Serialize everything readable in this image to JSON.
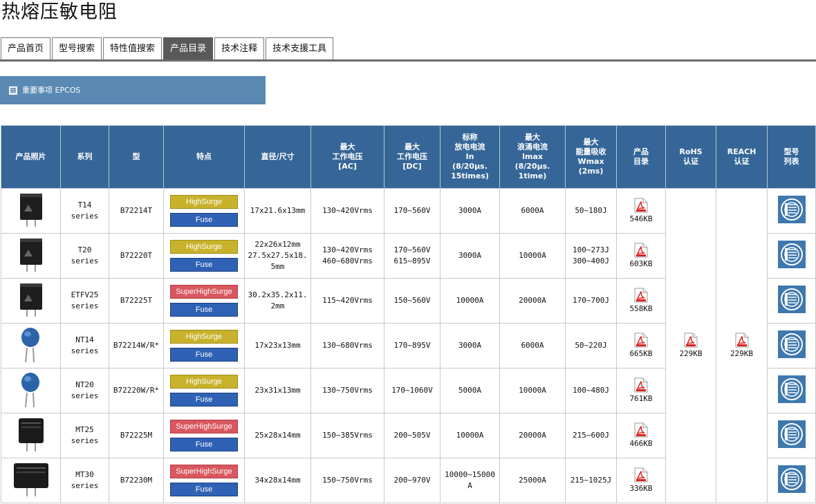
{
  "page": {
    "title": "热熔压敏电阻"
  },
  "tabs": [
    "产品首页",
    "型号搜索",
    "特性值搜索",
    "产品目录",
    "技术注释",
    "技术支援工具"
  ],
  "notice": {
    "label": "重要事项 EPCOS"
  },
  "table": {
    "headers": [
      [
        "产品照片"
      ],
      [
        "系列"
      ],
      [
        "型"
      ],
      [
        "特点"
      ],
      [
        "直径/尺寸"
      ],
      [
        "最大",
        "工作电压",
        "[AC]"
      ],
      [
        "最大",
        "工作电压",
        "[DC]"
      ],
      [
        "标称",
        "放电电流",
        "In",
        "(8/20µs.",
        "15times)"
      ],
      [
        "最大",
        "浪涌电流",
        "Imax",
        "(8/20µs.",
        "1time)"
      ],
      [
        "最大",
        "能量吸收",
        "Wmax",
        "(2ms)"
      ],
      [
        "产品",
        "目录"
      ],
      [
        "RoHS",
        "认证"
      ],
      [
        "REACH",
        "认证"
      ],
      [
        "型号",
        "列表"
      ]
    ],
    "rows": [
      {
        "series": [
          "T14",
          "series"
        ],
        "type": "B72214T",
        "feature": "HighSurge",
        "fuse": "Fuse",
        "dimension": [
          "17x21.6x13mm"
        ],
        "vac": [
          "130~420Vrms"
        ],
        "vdc": [
          "170~560V"
        ],
        "in": [
          "3000A"
        ],
        "imax": "6000A",
        "wmax": [
          "50~180J"
        ],
        "catalog": "546KB",
        "image": "black-box"
      },
      {
        "series": [
          "T20",
          "series"
        ],
        "type": "B72220T",
        "feature": "HighSurge",
        "fuse": "Fuse",
        "dimension": [
          "22x26x12mm",
          "27.5x27.5x18.",
          "5mm"
        ],
        "vac": [
          "130~420Vrms",
          "460~680Vrms"
        ],
        "vdc": [
          "170~560V",
          "615~895V"
        ],
        "in": [
          "3000A"
        ],
        "imax": "10000A",
        "wmax": [
          "100~273J",
          "300~400J"
        ],
        "catalog": "603KB",
        "image": "black-box"
      },
      {
        "series": [
          "ETFV25",
          "series"
        ],
        "type": "B72225T",
        "feature": "SuperHighSurge",
        "fuse": "Fuse",
        "dimension": [
          "30.2x35.2x11.",
          "2mm"
        ],
        "vac": [
          "115~420Vrms"
        ],
        "vdc": [
          "150~560V"
        ],
        "in": [
          "10000A"
        ],
        "imax": "20000A",
        "wmax": [
          "170~700J"
        ],
        "catalog": "558KB",
        "image": "black-box"
      },
      {
        "series": [
          "NT14",
          "series"
        ],
        "type": "B72214W/R*",
        "feature": "HighSurge",
        "fuse": "Fuse",
        "dimension": [
          "17x23x13mm"
        ],
        "vac": [
          "130~680Vrms"
        ],
        "vdc": [
          "170~895V"
        ],
        "in": [
          "3000A"
        ],
        "imax": "6000A",
        "wmax": [
          "50~220J"
        ],
        "catalog": "665KB",
        "image": "blue-disc"
      },
      {
        "series": [
          "NT20",
          "series"
        ],
        "type": "B72220W/R*",
        "feature": "HighSurge",
        "fuse": "Fuse",
        "dimension": [
          "23x31x13mm"
        ],
        "vac": [
          "130~750Vrms"
        ],
        "vdc": [
          "170~1060V"
        ],
        "in": [
          "5000A"
        ],
        "imax": "10000A",
        "wmax": [
          "100~480J"
        ],
        "catalog": "761KB",
        "image": "blue-disc"
      },
      {
        "series": [
          "MT25",
          "series"
        ],
        "type": "B72225M",
        "feature": "SuperHighSurge",
        "fuse": "Fuse",
        "dimension": [
          "25x28x14mm"
        ],
        "vac": [
          "150~385Vrms"
        ],
        "vdc": [
          "200~505V"
        ],
        "in": [
          "10000A"
        ],
        "imax": "20000A",
        "wmax": [
          "215~600J"
        ],
        "catalog": "466KB",
        "image": "black-module"
      },
      {
        "series": [
          "MT30",
          "series"
        ],
        "type": "B72230M",
        "feature": "SuperHighSurge",
        "fuse": "Fuse",
        "dimension": [
          "34x28x14mm"
        ],
        "vac": [
          "150~750Vrms"
        ],
        "vdc": [
          "200~970V"
        ],
        "in": [
          "10000~15000",
          "A"
        ],
        "imax": "25000A",
        "wmax": [
          "215~1025J"
        ],
        "catalog": "336KB",
        "image": "black-module-wide"
      }
    ],
    "rohs": "229KB",
    "reach": "229KB"
  },
  "colors": {
    "header": "#356697",
    "notice": "#5a89b3",
    "highsurge": "#c8b22b",
    "superhighsurge": "#d9575f",
    "fuse": "#2f62b5"
  }
}
